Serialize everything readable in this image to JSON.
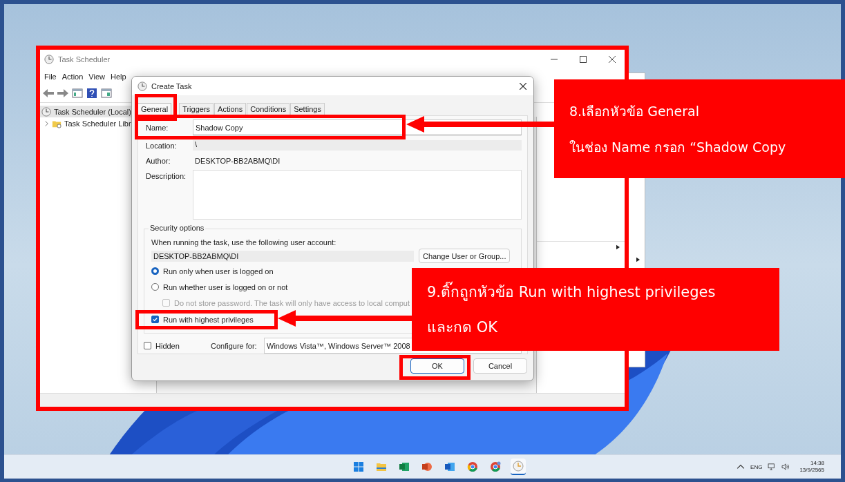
{
  "task_scheduler": {
    "title": "Task Scheduler",
    "menu": [
      "File",
      "Action",
      "View",
      "Help"
    ],
    "tree": [
      {
        "label": "Task Scheduler (Local)",
        "selected": true,
        "children": [
          {
            "label": "Task Scheduler Libr",
            "selected": false,
            "expanded": false
          }
        ]
      }
    ]
  },
  "dialog": {
    "title": "Create Task",
    "tabs": [
      {
        "label": "General",
        "selected": true
      },
      {
        "label": "Triggers",
        "selected": false
      },
      {
        "label": "Actions",
        "selected": false
      },
      {
        "label": "Conditions",
        "selected": false
      },
      {
        "label": "Settings",
        "selected": false
      }
    ],
    "name_label": "Name:",
    "name_value": "Shadow Copy",
    "location_label": "Location:",
    "location_value": "\\",
    "author_label": "Author:",
    "author_value": "DESKTOP-BB2ABMQ\\DI",
    "description_label": "Description:",
    "security": {
      "title": "Security options",
      "account_prompt": "When running the task, use the following user account:",
      "account": "DESKTOP-BB2ABMQ\\DI",
      "change_button": "Change User or Group...",
      "options": [
        {
          "label": "Run only when user is logged on",
          "selected": true
        },
        {
          "label": "Run whether user is logged on or not",
          "selected": false
        }
      ],
      "no_password": {
        "label": "Do not store password.  The task will only have access to local comput",
        "checked": false,
        "disabled": true
      },
      "highest": {
        "label": "Run with highest privileges",
        "checked": true
      }
    },
    "hidden": {
      "label": "Hidden",
      "checked": false
    },
    "configure_label": "Configure for:",
    "configure_value": "Windows Vista™, Windows Server™ 2008",
    "buttons": [
      {
        "label": "OK",
        "default": true
      },
      {
        "label": "Cancel",
        "default": false
      }
    ]
  },
  "callouts": [
    {
      "lines": [
        "8.เลือกหัวข้อ General",
        "ในช่อง Name กรอก “Shadow Copy"
      ]
    },
    {
      "lines": [
        "9.ติ๊กถูกหัวข้อ Run with highest privileges",
        "และกด OK"
      ]
    }
  ],
  "taskbar": {
    "language": "ENG",
    "time": "14:38",
    "date": "13/9/2565"
  }
}
